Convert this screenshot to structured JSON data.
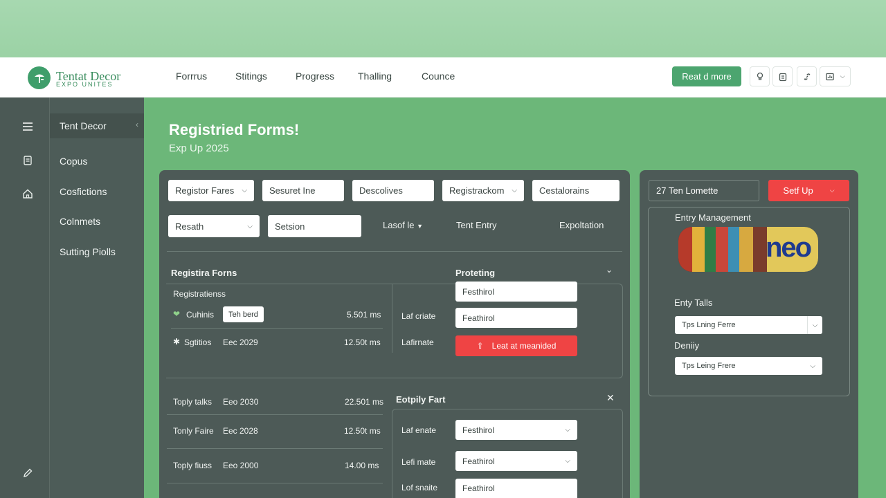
{
  "brand": {
    "name": "Tentat Decor",
    "tagline": "EXPO UNITES",
    "color": "#3f9e6b"
  },
  "nav": {
    "items": [
      "Forrrus",
      "Stitings",
      "Progress",
      "Thalling",
      "Counce"
    ],
    "cta": "Reat d more"
  },
  "topbar_icons": [
    "bulb-icon",
    "clipboard-icon",
    "link-icon",
    "chart-icon"
  ],
  "rail_icons": [
    "menu-icon",
    "document-icon",
    "home-icon",
    "edit-icon"
  ],
  "sidebar": {
    "active": "Tent Decor",
    "items": [
      "Copus",
      "Cosfictions",
      "Colnmets",
      "Sutting Piolls"
    ]
  },
  "page": {
    "title": "Registried Forms!",
    "subtitle": "Exp Up 2025"
  },
  "filters": {
    "row1": [
      {
        "label": "Registor Fares",
        "dropdown": true
      },
      {
        "label": "Sesuret Ine",
        "dropdown": false
      },
      {
        "label": "Descolives",
        "dropdown": false
      },
      {
        "label": "Registrackom",
        "dropdown": true
      },
      {
        "label": "Cestalorains",
        "dropdown": false
      }
    ],
    "row2": [
      {
        "label": "Resath",
        "dropdown": true
      },
      {
        "label": "Setsion",
        "dropdown": false
      }
    ],
    "row2_text": {
      "sort": "Lasof le",
      "col1": "Tent Entry",
      "col2": "Expoltation"
    }
  },
  "reg": {
    "title": "Registira Forns",
    "sub": "Registratienss",
    "rows": [
      {
        "icon": "heart-icon",
        "name": "Cuhinis",
        "tag": "Teh berd",
        "value": "5.501 ms"
      },
      {
        "icon": "gear-icon",
        "name": "Sgtitios",
        "date": "Eec 2029",
        "value": "12.50t ms"
      }
    ]
  },
  "protecting": {
    "title": "Proteting",
    "fields": [
      "Festhirol",
      "Feathirol"
    ],
    "labels": [
      "Laf criate",
      "Lafirnate"
    ],
    "button": "Leat at meanided"
  },
  "lower": {
    "rows": [
      {
        "name": "Toply talks",
        "date": "Eeo 2030",
        "value": "22.501 ms"
      },
      {
        "name": "Tonly Faire",
        "date": "Eec 2028",
        "value": "12.50t ms"
      },
      {
        "name": "Toply fiuss",
        "date": "Eeo 2000",
        "value": "14.00 ms"
      }
    ]
  },
  "employ": {
    "title": "Eotpily Fart",
    "rows": [
      {
        "label": "Laf enate",
        "value": "Festhirol"
      },
      {
        "label": "Lefi mate",
        "value": "Feathirol"
      },
      {
        "label": "Lof snaite",
        "value": "Feathirol"
      }
    ]
  },
  "right": {
    "input": "27 Ten Lomette",
    "button": "Setf Up",
    "entry_title": "Entry Management",
    "image_text": "neo",
    "tails_label": "Enty Talls",
    "tails_select": "Tps Lning Ferre",
    "density_label": "Deniiy",
    "density_select": "Tps Leing Frere"
  },
  "colors": {
    "accent": "#4ca56f",
    "danger": "#ef4444",
    "panel": "#4d5a57"
  }
}
